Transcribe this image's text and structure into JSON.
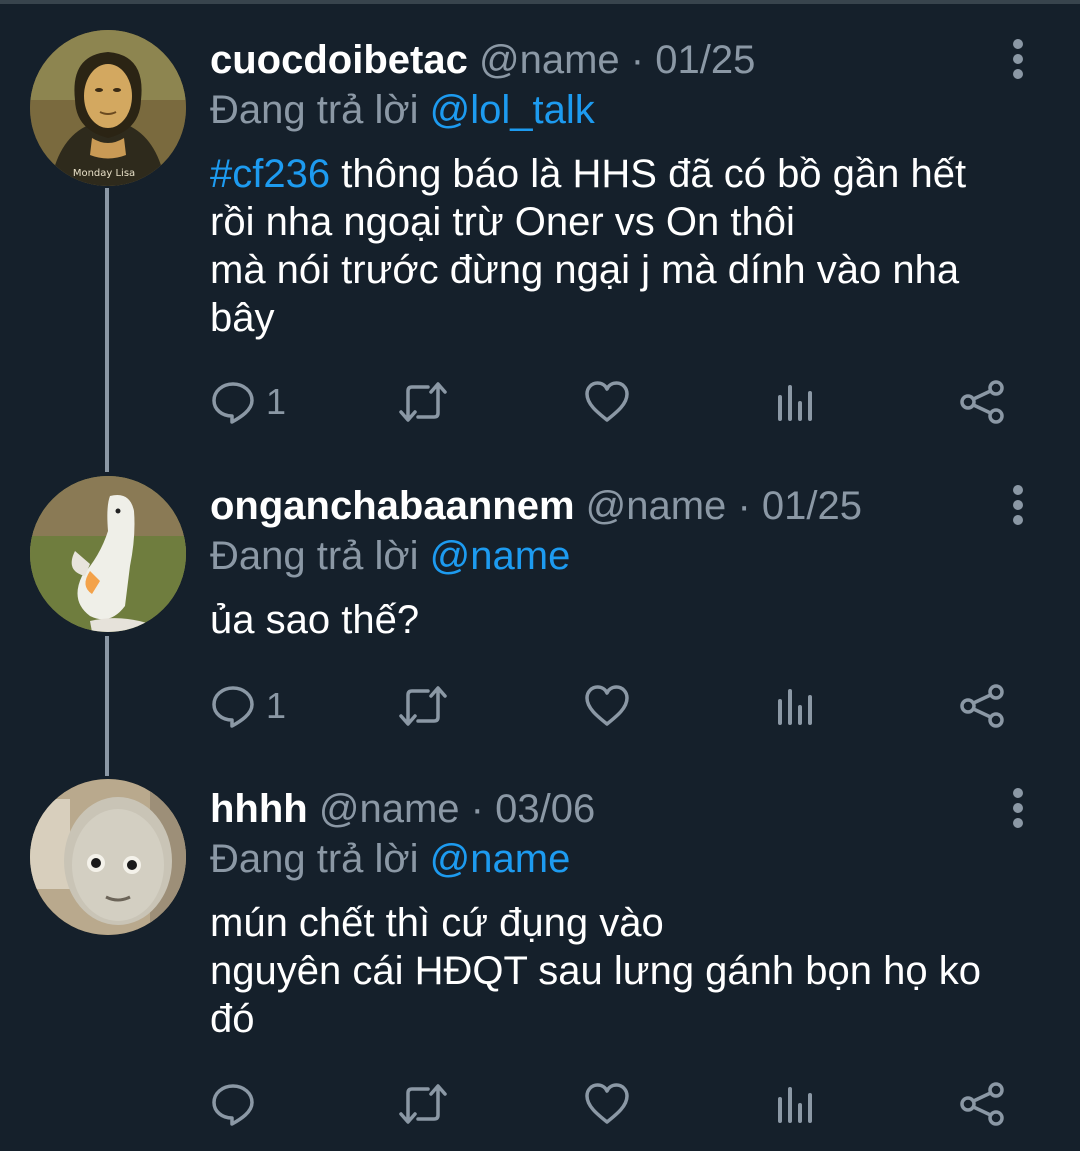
{
  "reply_prefix": "Đang trả lời",
  "tweets": [
    {
      "username": "cuocdoibetac",
      "handle": "@name",
      "separator": "·",
      "date": "01/25",
      "reply_to": "@lol_talk",
      "avatar_caption": "Monday Lisa",
      "hashtag": "#cf236",
      "lines": [
        " thông báo là HHS đã có bồ gần hết",
        "rồi nha ngoại trừ Oner vs On thôi",
        "mà nói trước đừng ngại j mà dính vào nha",
        "bây"
      ],
      "reply_count": "1"
    },
    {
      "username": "onganchabaannem",
      "handle": "@name",
      "separator": "·",
      "date": "01/25",
      "reply_to": "@name",
      "lines": [
        "ủa sao thế?"
      ],
      "reply_count": "1"
    },
    {
      "username": "hhhh",
      "handle": "@name",
      "separator": "·",
      "date": "03/06",
      "reply_to": "@name",
      "lines": [
        "mún chết thì cứ đụng vào",
        "nguyên cái HĐQT sau lưng gánh bọn họ ko",
        "đó"
      ],
      "reply_count": ""
    }
  ],
  "icons": {
    "reply": "speech-bubble-icon",
    "retweet": "retweet-arrows-icon",
    "like": "heart-icon",
    "views": "bar-chart-icon",
    "share": "share-nodes-icon",
    "more": "vertical-ellipsis-icon"
  },
  "colors": {
    "background": "#15202b",
    "text": "#ffffff",
    "muted": "#8b98a5",
    "link": "#1d9bf0"
  }
}
